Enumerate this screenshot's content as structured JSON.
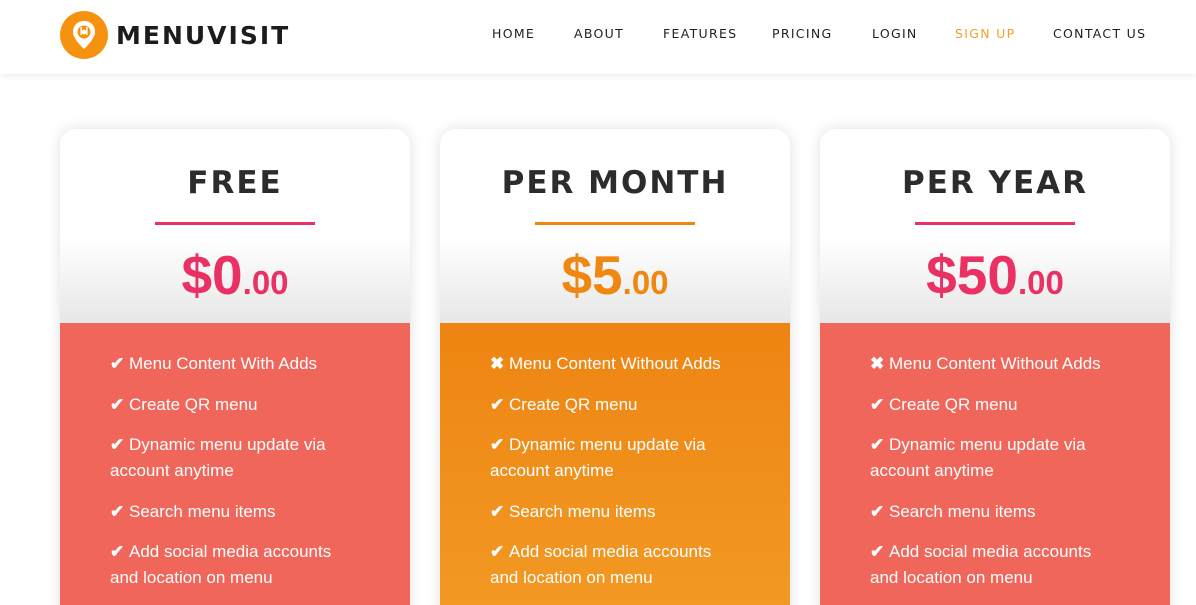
{
  "brand": {
    "name": "MENUVISIT",
    "logo_icon": "map-pin-plate-icon",
    "color": "#f5920f"
  },
  "nav": {
    "items": [
      {
        "label": "HOME",
        "active": false
      },
      {
        "label": "ABOUT",
        "active": false
      },
      {
        "label": "FEATURES",
        "active": false
      },
      {
        "label": "PRICING",
        "active": false
      },
      {
        "label": "LOGIN",
        "active": false
      },
      {
        "label": "SIGN UP",
        "active": true
      },
      {
        "label": "CONTACT US",
        "active": false
      }
    ],
    "active_color": "#f1a12a"
  },
  "plans": [
    {
      "title": "FREE",
      "price": {
        "amount": "$0",
        "cents": ".00"
      },
      "accent_color": "#ea3163",
      "body_color": "#f0665a",
      "features": [
        {
          "icon": "check-icon",
          "glyph": "✔",
          "text": "Menu Content With Adds"
        },
        {
          "icon": "check-icon",
          "glyph": "✔",
          "text": "Create QR menu"
        },
        {
          "icon": "check-icon",
          "glyph": "✔",
          "text": "Dynamic menu update via account anytime"
        },
        {
          "icon": "check-icon",
          "glyph": "✔",
          "text": "Search menu items"
        },
        {
          "icon": "check-icon",
          "glyph": "✔",
          "text": "Add social media accounts and location on menu"
        }
      ]
    },
    {
      "title": "PER MONTH",
      "price": {
        "amount": "$5",
        "cents": ".00"
      },
      "accent_color": "#ef8710",
      "body_color": "#f08d18",
      "features": [
        {
          "icon": "cross-icon",
          "glyph": "✖",
          "text": "Menu Content Without Adds"
        },
        {
          "icon": "check-icon",
          "glyph": "✔",
          "text": "Create QR menu"
        },
        {
          "icon": "check-icon",
          "glyph": "✔",
          "text": "Dynamic menu update via account anytime"
        },
        {
          "icon": "check-icon",
          "glyph": "✔",
          "text": "Search menu items"
        },
        {
          "icon": "check-icon",
          "glyph": "✔",
          "text": "Add social media accounts and location on menu"
        }
      ]
    },
    {
      "title": "PER YEAR",
      "price": {
        "amount": "$50",
        "cents": ".00"
      },
      "accent_color": "#ea3163",
      "body_color": "#f0665a",
      "features": [
        {
          "icon": "cross-icon",
          "glyph": "✖",
          "text": "Menu Content Without Adds"
        },
        {
          "icon": "check-icon",
          "glyph": "✔",
          "text": "Create QR menu"
        },
        {
          "icon": "check-icon",
          "glyph": "✔",
          "text": "Dynamic menu update via account anytime"
        },
        {
          "icon": "check-icon",
          "glyph": "✔",
          "text": "Search menu items"
        },
        {
          "icon": "check-icon",
          "glyph": "✔",
          "text": "Add social media accounts and location on menu"
        }
      ]
    }
  ]
}
